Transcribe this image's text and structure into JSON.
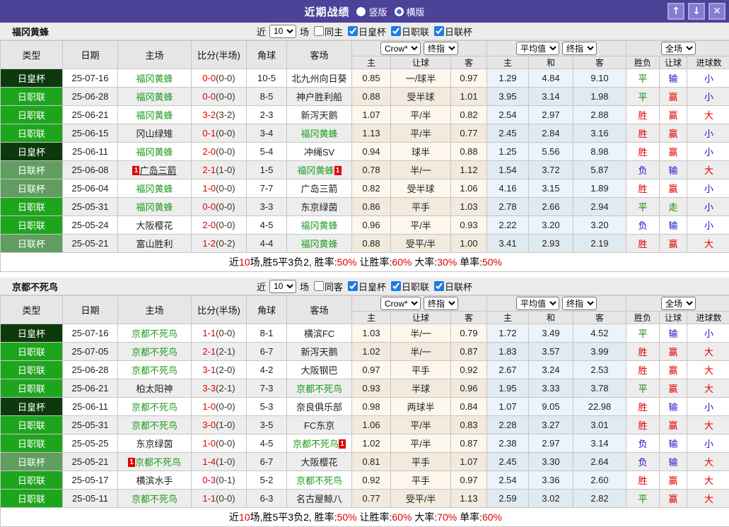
{
  "titlebar": {
    "title": "近期战绩",
    "radios": [
      {
        "label": "竖版",
        "selected": true
      },
      {
        "label": "横版",
        "selected": false
      }
    ],
    "window_buttons": [
      {
        "name": "move-up",
        "glyph": "↑"
      },
      {
        "name": "move-down",
        "glyph": "↓"
      },
      {
        "name": "close",
        "glyph": "✕"
      }
    ]
  },
  "filter_labels": {
    "near": "近",
    "count": "10",
    "unit": "场",
    "cups": [
      "日皇杯",
      "日职联",
      "日联杯"
    ]
  },
  "columns": {
    "main": [
      "类型",
      "日期",
      "主场",
      "比分(半场)",
      "角球",
      "客场"
    ],
    "odds_group": {
      "select1": "Crow*",
      "select2": "终指",
      "cols": [
        "主",
        "让球",
        "客"
      ]
    },
    "avg_group": {
      "select1": "平均值",
      "select2": "终指",
      "cols": [
        "主",
        "和",
        "客"
      ]
    },
    "result_group": {
      "select1": "全场",
      "cols": [
        "胜负",
        "让球",
        "进球数"
      ]
    }
  },
  "colors": {
    "titlebar": "#4c4298",
    "button": "#837cd0",
    "team_green": "#1e9b1e",
    "red": "#e00000",
    "green": "#0a8a0a",
    "blue": "#1616cc",
    "type_colors": {
      "日皇杯": "#0d3a0d",
      "日职联": "#1ea51e",
      "日联杯": "#5f9e5f"
    }
  },
  "sections": [
    {
      "team": "福冈黄蜂",
      "same_checkbox": {
        "label": "同主",
        "checked": false
      },
      "rows": [
        {
          "type": "日皇杯",
          "date": "25-07-16",
          "home": {
            "name": "福冈黄蜂",
            "green": true
          },
          "score": "0-0",
          "half": "(0-0)",
          "corners": "10-5",
          "away": {
            "name": "北九州向日葵"
          },
          "crow": [
            "0.85",
            "一/球半",
            "0.97"
          ],
          "avg": [
            "1.29",
            "4.84",
            "9.10"
          ],
          "results": [
            {
              "text": "平",
              "color": "green"
            },
            {
              "text": "输",
              "color": "blue"
            },
            {
              "text": "小",
              "color": "blue"
            }
          ]
        },
        {
          "type": "日职联",
          "date": "25-06-28",
          "home": {
            "name": "福冈黄蜂",
            "green": true
          },
          "score": "0-0",
          "half": "(0-0)",
          "corners": "8-5",
          "away": {
            "name": "神户胜利船"
          },
          "crow": [
            "0.88",
            "受半球",
            "1.01"
          ],
          "avg": [
            "3.95",
            "3.14",
            "1.98"
          ],
          "results": [
            {
              "text": "平",
              "color": "green"
            },
            {
              "text": "赢",
              "color": "red"
            },
            {
              "text": "小",
              "color": "blue"
            }
          ]
        },
        {
          "type": "日职联",
          "date": "25-06-21",
          "home": {
            "name": "福冈黄蜂",
            "green": true
          },
          "score": "3-2",
          "half": "(3-2)",
          "corners": "2-3",
          "away": {
            "name": "新泻天鹅"
          },
          "crow": [
            "1.07",
            "平/半",
            "0.82"
          ],
          "avg": [
            "2.54",
            "2.97",
            "2.88"
          ],
          "results": [
            {
              "text": "胜",
              "color": "red"
            },
            {
              "text": "赢",
              "color": "red"
            },
            {
              "text": "大",
              "color": "red"
            }
          ]
        },
        {
          "type": "日职联",
          "date": "25-06-15",
          "home": {
            "name": "冈山绿雉"
          },
          "score": "0-1",
          "half": "(0-0)",
          "corners": "3-4",
          "away": {
            "name": "福冈黄蜂",
            "green": true
          },
          "crow": [
            "1.13",
            "平/半",
            "0.77"
          ],
          "avg": [
            "2.45",
            "2.84",
            "3.16"
          ],
          "results": [
            {
              "text": "胜",
              "color": "red"
            },
            {
              "text": "赢",
              "color": "red"
            },
            {
              "text": "小",
              "color": "blue"
            }
          ]
        },
        {
          "type": "日皇杯",
          "date": "25-06-11",
          "home": {
            "name": "福冈黄蜂",
            "green": true
          },
          "score": "2-0",
          "half": "(0-0)",
          "corners": "5-4",
          "away": {
            "name": "冲绳SV"
          },
          "crow": [
            "0.94",
            "球半",
            "0.88"
          ],
          "avg": [
            "1.25",
            "5.56",
            "8.98"
          ],
          "results": [
            {
              "text": "胜",
              "color": "red"
            },
            {
              "text": "赢",
              "color": "red"
            },
            {
              "text": "小",
              "color": "blue"
            }
          ]
        },
        {
          "type": "日联杯",
          "date": "25-06-08",
          "home": {
            "name": "广岛三箭",
            "badge_before": true,
            "underline": true
          },
          "score": "2-1",
          "half": "(1-0)",
          "corners": "1-5",
          "away": {
            "name": "福冈黄蜂",
            "green": true,
            "badge_after": true
          },
          "crow": [
            "0.78",
            "半/一",
            "1.12"
          ],
          "avg": [
            "1.54",
            "3.72",
            "5.87"
          ],
          "results": [
            {
              "text": "负",
              "color": "blue"
            },
            {
              "text": "输",
              "color": "blue"
            },
            {
              "text": "大",
              "color": "red"
            }
          ]
        },
        {
          "type": "日联杯",
          "date": "25-06-04",
          "home": {
            "name": "福冈黄蜂",
            "green": true
          },
          "score": "1-0",
          "half": "(0-0)",
          "corners": "7-7",
          "away": {
            "name": "广岛三箭"
          },
          "crow": [
            "0.82",
            "受半球",
            "1.06"
          ],
          "avg": [
            "4.16",
            "3.15",
            "1.89"
          ],
          "results": [
            {
              "text": "胜",
              "color": "red"
            },
            {
              "text": "赢",
              "color": "red"
            },
            {
              "text": "小",
              "color": "blue"
            }
          ]
        },
        {
          "type": "日职联",
          "date": "25-05-31",
          "home": {
            "name": "福冈黄蜂",
            "green": true
          },
          "score": "0-0",
          "half": "(0-0)",
          "corners": "3-3",
          "away": {
            "name": "东京绿茵"
          },
          "crow": [
            "0.86",
            "平手",
            "1.03"
          ],
          "avg": [
            "2.78",
            "2.66",
            "2.94"
          ],
          "results": [
            {
              "text": "平",
              "color": "green"
            },
            {
              "text": "走",
              "color": "green"
            },
            {
              "text": "小",
              "color": "blue"
            }
          ]
        },
        {
          "type": "日职联",
          "date": "25-05-24",
          "home": {
            "name": "大阪樱花"
          },
          "score": "2-0",
          "half": "(0-0)",
          "corners": "4-5",
          "away": {
            "name": "福冈黄蜂",
            "green": true
          },
          "crow": [
            "0.96",
            "平/半",
            "0.93"
          ],
          "avg": [
            "2.22",
            "3.20",
            "3.20"
          ],
          "results": [
            {
              "text": "负",
              "color": "blue"
            },
            {
              "text": "输",
              "color": "blue"
            },
            {
              "text": "小",
              "color": "blue"
            }
          ]
        },
        {
          "type": "日联杯",
          "date": "25-05-21",
          "home": {
            "name": "富山胜利"
          },
          "score": "1-2",
          "half": "(0-2)",
          "corners": "4-4",
          "away": {
            "name": "福冈黄蜂",
            "green": true
          },
          "crow": [
            "0.88",
            "受平/半",
            "1.00"
          ],
          "avg": [
            "3.41",
            "2.93",
            "2.19"
          ],
          "results": [
            {
              "text": "胜",
              "color": "red"
            },
            {
              "text": "赢",
              "color": "red"
            },
            {
              "text": "大",
              "color": "red"
            }
          ]
        }
      ],
      "summary": [
        {
          "text": "近",
          "red": false
        },
        {
          "text": "10",
          "red": true
        },
        {
          "text": "场,胜5平3负2, 胜率:",
          "red": false
        },
        {
          "text": "50%",
          "red": true
        },
        {
          "text": " 让胜率:",
          "red": false
        },
        {
          "text": "60%",
          "red": true
        },
        {
          "text": " 大率:",
          "red": false
        },
        {
          "text": "30%",
          "red": true
        },
        {
          "text": " 单率:",
          "red": false
        },
        {
          "text": "50%",
          "red": true
        }
      ]
    },
    {
      "team": "京都不死鸟",
      "same_checkbox": {
        "label": "同客",
        "checked": false
      },
      "rows": [
        {
          "type": "日皇杯",
          "date": "25-07-16",
          "home": {
            "name": "京都不死鸟",
            "green": true
          },
          "score": "1-1",
          "half": "(0-0)",
          "corners": "8-1",
          "away": {
            "name": "横滨FC"
          },
          "crow": [
            "1.03",
            "半/一",
            "0.79"
          ],
          "avg": [
            "1.72",
            "3.49",
            "4.52"
          ],
          "results": [
            {
              "text": "平",
              "color": "green"
            },
            {
              "text": "输",
              "color": "blue"
            },
            {
              "text": "小",
              "color": "blue"
            }
          ]
        },
        {
          "type": "日职联",
          "date": "25-07-05",
          "home": {
            "name": "京都不死鸟",
            "green": true
          },
          "score": "2-1",
          "half": "(2-1)",
          "corners": "6-7",
          "away": {
            "name": "新泻天鹅"
          },
          "crow": [
            "1.02",
            "半/一",
            "0.87"
          ],
          "avg": [
            "1.83",
            "3.57",
            "3.99"
          ],
          "results": [
            {
              "text": "胜",
              "color": "red"
            },
            {
              "text": "赢",
              "color": "red"
            },
            {
              "text": "大",
              "color": "red"
            }
          ]
        },
        {
          "type": "日职联",
          "date": "25-06-28",
          "home": {
            "name": "京都不死鸟",
            "green": true
          },
          "score": "3-1",
          "half": "(2-0)",
          "corners": "4-2",
          "away": {
            "name": "大阪钢巴"
          },
          "crow": [
            "0.97",
            "平手",
            "0.92"
          ],
          "avg": [
            "2.67",
            "3.24",
            "2.53"
          ],
          "results": [
            {
              "text": "胜",
              "color": "red"
            },
            {
              "text": "赢",
              "color": "red"
            },
            {
              "text": "大",
              "color": "red"
            }
          ]
        },
        {
          "type": "日职联",
          "date": "25-06-21",
          "home": {
            "name": "柏太阳神"
          },
          "score": "3-3",
          "half": "(2-1)",
          "corners": "7-3",
          "away": {
            "name": "京都不死鸟",
            "green": true
          },
          "crow": [
            "0.93",
            "半球",
            "0.96"
          ],
          "avg": [
            "1.95",
            "3.33",
            "3.78"
          ],
          "results": [
            {
              "text": "平",
              "color": "green"
            },
            {
              "text": "赢",
              "color": "red"
            },
            {
              "text": "大",
              "color": "red"
            }
          ]
        },
        {
          "type": "日皇杯",
          "date": "25-06-11",
          "home": {
            "name": "京都不死鸟",
            "green": true
          },
          "score": "1-0",
          "half": "(0-0)",
          "corners": "5-3",
          "away": {
            "name": "奈良俱乐部"
          },
          "crow": [
            "0.98",
            "两球半",
            "0.84"
          ],
          "avg": [
            "1.07",
            "9.05",
            "22.98"
          ],
          "results": [
            {
              "text": "胜",
              "color": "red"
            },
            {
              "text": "输",
              "color": "blue"
            },
            {
              "text": "小",
              "color": "blue"
            }
          ]
        },
        {
          "type": "日职联",
          "date": "25-05-31",
          "home": {
            "name": "京都不死鸟",
            "green": true
          },
          "score": "3-0",
          "half": "(1-0)",
          "corners": "3-5",
          "away": {
            "name": "FC东京"
          },
          "crow": [
            "1.06",
            "平/半",
            "0.83"
          ],
          "avg": [
            "2.28",
            "3.27",
            "3.01"
          ],
          "results": [
            {
              "text": "胜",
              "color": "red"
            },
            {
              "text": "赢",
              "color": "red"
            },
            {
              "text": "大",
              "color": "red"
            }
          ]
        },
        {
          "type": "日职联",
          "date": "25-05-25",
          "home": {
            "name": "东京绿茵"
          },
          "score": "1-0",
          "half": "(0-0)",
          "corners": "4-5",
          "away": {
            "name": "京都不死鸟",
            "green": true,
            "badge_after": true
          },
          "crow": [
            "1.02",
            "平/半",
            "0.87"
          ],
          "avg": [
            "2.38",
            "2.97",
            "3.14"
          ],
          "results": [
            {
              "text": "负",
              "color": "blue"
            },
            {
              "text": "输",
              "color": "blue"
            },
            {
              "text": "小",
              "color": "blue"
            }
          ]
        },
        {
          "type": "日联杯",
          "date": "25-05-21",
          "home": {
            "name": "京都不死鸟",
            "green": true,
            "badge_before": true
          },
          "score": "1-4",
          "half": "(1-0)",
          "corners": "6-7",
          "away": {
            "name": "大阪樱花"
          },
          "crow": [
            "0.81",
            "平手",
            "1.07"
          ],
          "avg": [
            "2.45",
            "3.30",
            "2.64"
          ],
          "results": [
            {
              "text": "负",
              "color": "blue"
            },
            {
              "text": "输",
              "color": "blue"
            },
            {
              "text": "大",
              "color": "red"
            }
          ]
        },
        {
          "type": "日职联",
          "date": "25-05-17",
          "home": {
            "name": "横滨水手"
          },
          "score": "0-3",
          "half": "(0-1)",
          "corners": "5-2",
          "away": {
            "name": "京都不死鸟",
            "green": true
          },
          "crow": [
            "0.92",
            "平手",
            "0.97"
          ],
          "avg": [
            "2.54",
            "3.36",
            "2.60"
          ],
          "results": [
            {
              "text": "胜",
              "color": "red"
            },
            {
              "text": "赢",
              "color": "red"
            },
            {
              "text": "大",
              "color": "red"
            }
          ]
        },
        {
          "type": "日职联",
          "date": "25-05-11",
          "home": {
            "name": "京都不死鸟",
            "green": true
          },
          "score": "1-1",
          "half": "(0-0)",
          "corners": "6-3",
          "away": {
            "name": "名古屋鲸八"
          },
          "crow": [
            "0.77",
            "受平/半",
            "1.13"
          ],
          "avg": [
            "2.59",
            "3.02",
            "2.82"
          ],
          "results": [
            {
              "text": "平",
              "color": "green"
            },
            {
              "text": "赢",
              "color": "red"
            },
            {
              "text": "大",
              "color": "red"
            }
          ]
        }
      ],
      "summary": [
        {
          "text": "近",
          "red": false
        },
        {
          "text": "10",
          "red": true
        },
        {
          "text": "场,胜5平3负2, 胜率:",
          "red": false
        },
        {
          "text": "50%",
          "red": true
        },
        {
          "text": " 让胜率:",
          "red": false
        },
        {
          "text": "60%",
          "red": true
        },
        {
          "text": " 大率:",
          "red": false
        },
        {
          "text": "70%",
          "red": true
        },
        {
          "text": " 单率:",
          "red": false
        },
        {
          "text": "60%",
          "red": true
        }
      ]
    }
  ]
}
